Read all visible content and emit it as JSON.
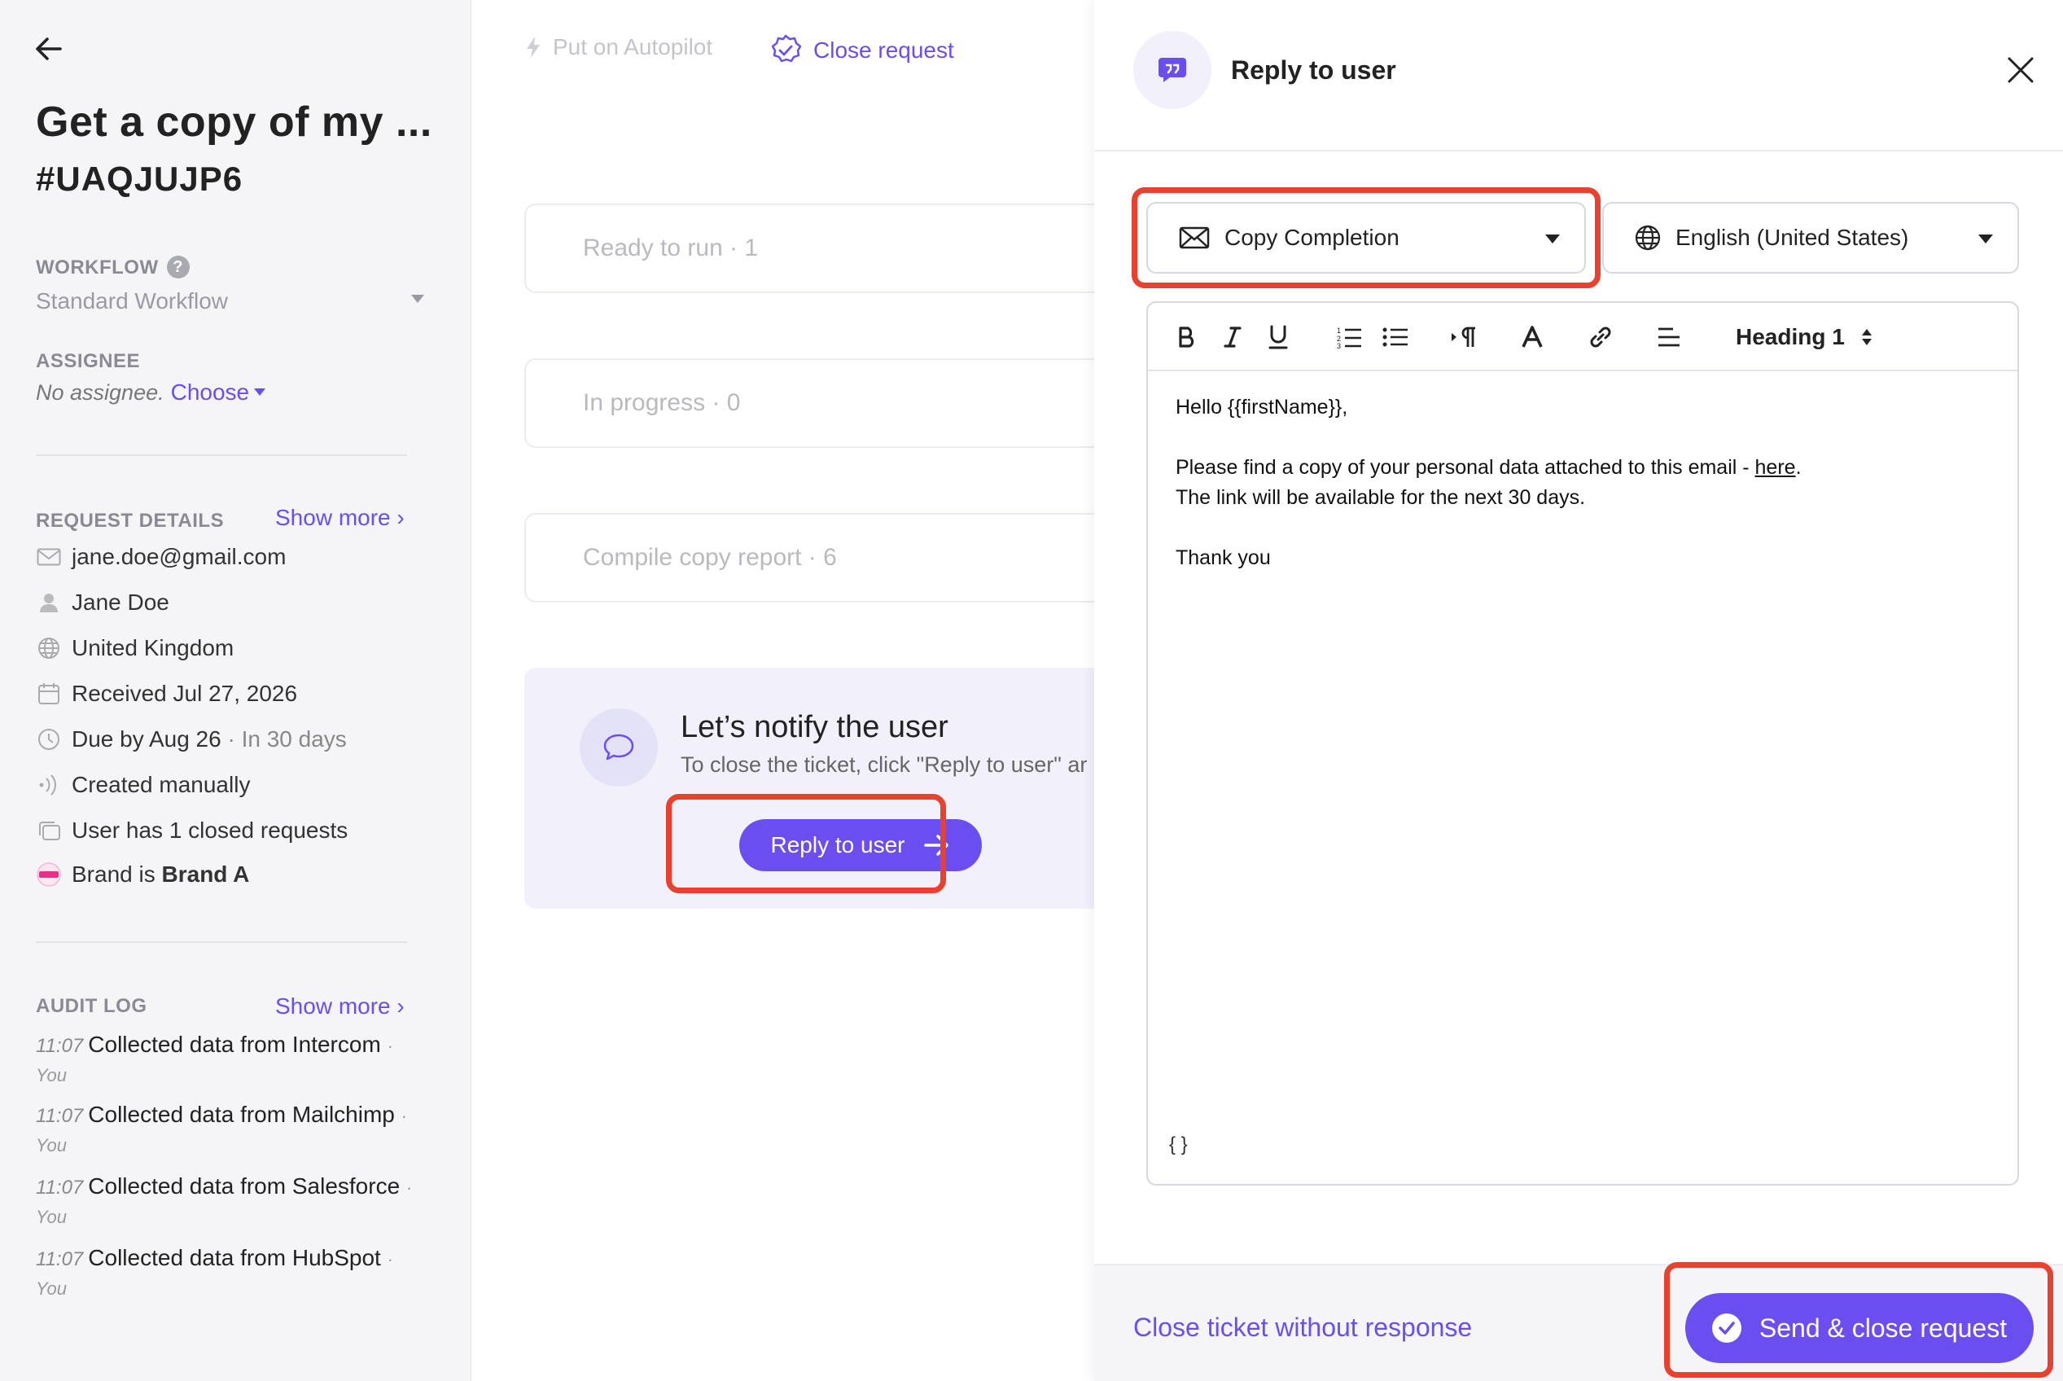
{
  "sidebar": {
    "title": "Get a copy of my ...",
    "ticket_id": "#UAQJUJP6",
    "workflow_label": "WORKFLOW",
    "workflow_help": "?",
    "workflow_value": "Standard Workflow",
    "assignee_label": "ASSIGNEE",
    "assignee_value": "No assignee.",
    "assignee_choose": "Choose",
    "request_details_label": "REQUEST DETAILS",
    "request_details_show_more": "Show more ›",
    "details": {
      "email": "jane.doe@gmail.com",
      "name": "Jane Doe",
      "country": "United Kingdom",
      "received": "Received Jul 27, 2026",
      "due": "Due by Aug 26",
      "due_relative": "· In 30 days",
      "created": "Created manually",
      "closed_requests": "User has 1 closed requests",
      "brand_prefix": "Brand is",
      "brand_name": "Brand A"
    },
    "audit_log_label": "AUDIT LOG",
    "audit_log_show_more": "Show more ›",
    "audit": [
      {
        "time": "11:07",
        "text": "Collected data from Intercom",
        "by": "· You"
      },
      {
        "time": "11:07",
        "text": "Collected data from Mailchimp",
        "by": "· You"
      },
      {
        "time": "11:07",
        "text": "Collected data from Salesforce",
        "by": "· You"
      },
      {
        "time": "11:07",
        "text": "Collected data from HubSpot",
        "by": "· You"
      }
    ]
  },
  "middle": {
    "autopilot_label": "Put on Autopilot",
    "close_request_label": "Close request",
    "stages": [
      {
        "label": "Ready to run · 1"
      },
      {
        "label": "In progress · 0"
      },
      {
        "label": "Compile copy report · 6"
      }
    ],
    "notify": {
      "title": "Let’s notify the user",
      "subtitle": "To close the ticket, click \"Reply to user\" ar",
      "button_label": "Reply to user"
    }
  },
  "panel": {
    "title": "Reply to user",
    "template_value": "Copy Completion",
    "language_value": "English (United States)",
    "heading_value": "Heading 1",
    "body": {
      "greeting": "Hello {{firstName}},",
      "line1": "Please find a copy of your personal data attached to this email - ",
      "link": "here",
      "line1_end": ".",
      "line2": "The link will be available for the next 30 days.",
      "signoff": "Thank you"
    },
    "braces": "{ }",
    "close_without_response": "Close ticket without response",
    "send_button": "Send & close request"
  },
  "colors": {
    "accent": "#6b4ef0",
    "highlight": "#e8412f",
    "sidebar_bg": "#f5f5f7",
    "notify_bg": "#f1f0fb"
  },
  "icons": [
    "back-arrow-icon",
    "help-icon",
    "mail-icon",
    "user-icon",
    "globe-icon",
    "calendar-icon",
    "clock-icon",
    "signal-icon",
    "stack-icon",
    "brand-icon",
    "bolt-icon",
    "badge-check-icon",
    "chat-bubble-icon",
    "arrow-right-icon",
    "quote-bubble-icon",
    "close-icon",
    "envelope-icon",
    "bold-icon",
    "italic-icon",
    "underline-icon",
    "ordered-list-icon",
    "bullet-list-icon",
    "paragraph-icon",
    "text-color-icon",
    "link-icon",
    "align-icon",
    "check-circle-icon"
  ]
}
